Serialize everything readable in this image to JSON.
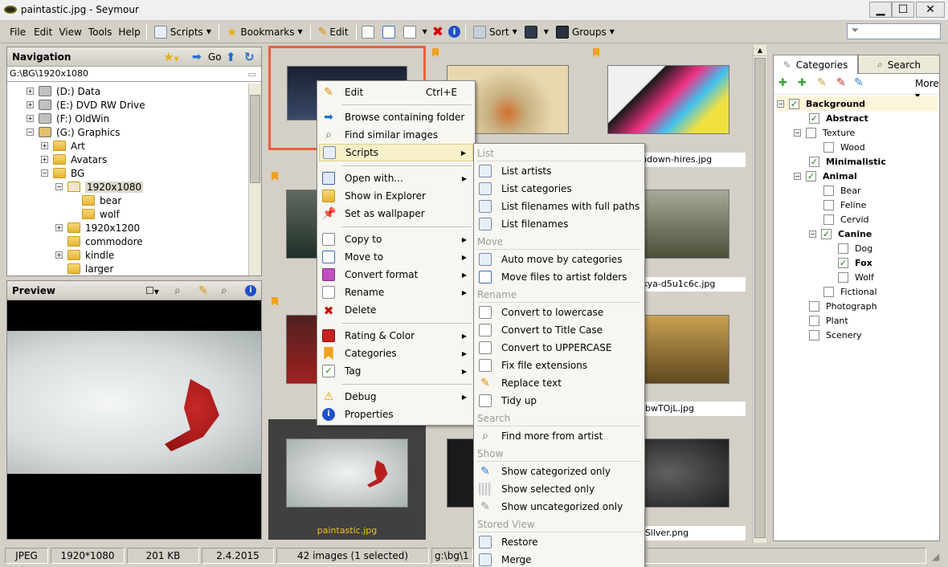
{
  "window": {
    "title": "paintastic.jpg - Seymour",
    "minimize": "▁",
    "maximize": "☐",
    "close": "✕"
  },
  "menu": {
    "file": "File",
    "edit": "Edit",
    "view": "View",
    "tools": "Tools",
    "help": "Help"
  },
  "toolbar": {
    "scripts": "Scripts",
    "bookmarks": "Bookmarks",
    "edit": "Edit",
    "sort": "Sort",
    "groups": "Groups"
  },
  "navigation": {
    "title": "Navigation",
    "go": "Go",
    "path": "G:\\BG\\1920x1080",
    "tree": [
      "(D:) Data",
      "(E:) DVD RW Drive",
      "(F:) OldWin",
      "(G:) Graphics",
      "Art",
      "Avatars",
      "BG",
      "1920x1080",
      "bear",
      "wolf",
      "1920x1200",
      "commodore",
      "kindle",
      "larger"
    ]
  },
  "preview": {
    "title": "Preview"
  },
  "grid": {
    "files": {
      "f3": "etyoudown-hires.jpg",
      "f6": "y_batkya-d5u1c6c.jpg",
      "f9": "0bwTOjL.jpg",
      "f10": "paintastic.jpg",
      "f12": "Silver.png"
    }
  },
  "categories": {
    "tab_categories": "Categories",
    "tab_search": "Search",
    "more": "More",
    "items": [
      {
        "label": "Background",
        "checked": true,
        "bold": true
      },
      {
        "label": "Abstract",
        "checked": true,
        "bold": true
      },
      {
        "label": "Texture",
        "checked": false,
        "bold": false
      },
      {
        "label": "Wood",
        "checked": false,
        "bold": false
      },
      {
        "label": "Minimalistic",
        "checked": true,
        "bold": true
      },
      {
        "label": "Animal",
        "checked": true,
        "bold": true
      },
      {
        "label": "Bear",
        "checked": false,
        "bold": false
      },
      {
        "label": "Feline",
        "checked": false,
        "bold": false
      },
      {
        "label": "Cervid",
        "checked": false,
        "bold": false
      },
      {
        "label": "Canine",
        "checked": true,
        "bold": true
      },
      {
        "label": "Dog",
        "checked": false,
        "bold": false
      },
      {
        "label": "Fox",
        "checked": true,
        "bold": true
      },
      {
        "label": "Wolf",
        "checked": false,
        "bold": false
      },
      {
        "label": "Fictional",
        "checked": false,
        "bold": false
      },
      {
        "label": "Photograph",
        "checked": false,
        "bold": false
      },
      {
        "label": "Plant",
        "checked": false,
        "bold": false
      },
      {
        "label": "Scenery",
        "checked": false,
        "bold": false
      }
    ]
  },
  "context_menu": {
    "edit": "Edit",
    "edit_shortcut": "Ctrl+E",
    "browse": "Browse containing folder",
    "similar": "Find similar images",
    "scripts": "Scripts",
    "open_with": "Open with...",
    "show_explorer": "Show in Explorer",
    "wallpaper": "Set as wallpaper",
    "copy_to": "Copy to",
    "move_to": "Move to",
    "convert_format": "Convert format",
    "rename": "Rename",
    "delete": "Delete",
    "rating": "Rating & Color",
    "categories": "Categories",
    "tag": "Tag",
    "debug": "Debug",
    "properties": "Properties"
  },
  "scripts_menu": {
    "h_list": "List",
    "list_artists": "List artists",
    "list_categories": "List categories",
    "list_filenames_paths": "List filenames with full paths",
    "list_filenames": "List filenames",
    "h_move": "Move",
    "auto_move": "Auto move by categories",
    "move_artist": "Move files to artist folders",
    "h_rename": "Rename",
    "lowercase": "Convert to lowercase",
    "titlecase": "Convert to Title Case",
    "uppercase": "Convert to UPPERCASE",
    "fix_ext": "Fix file extensions",
    "replace": "Replace text",
    "tidy": "Tidy up",
    "h_search": "Search",
    "find_artist": "Find more from artist",
    "h_show": "Show",
    "show_categorized": "Show categorized only",
    "show_selected": "Show selected only",
    "show_uncategorized": "Show uncategorized only",
    "h_stored": "Stored View",
    "restore": "Restore",
    "merge": "Merge"
  },
  "status": {
    "format": "JPEG",
    "dimensions": "1920*1080",
    "size": "201 KB",
    "date": "2.4.2015",
    "count": "42 images (1 selected)",
    "path": "g:\\bg\\1"
  }
}
